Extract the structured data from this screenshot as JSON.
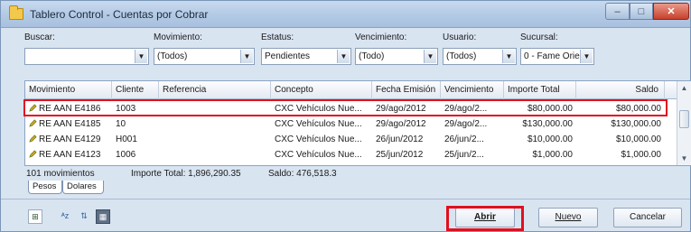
{
  "window": {
    "title": "Tablero Control - Cuentas por Cobrar",
    "controls": {
      "minimize": "–",
      "maximize": "□",
      "close": "✕"
    }
  },
  "filters": {
    "buscar": {
      "label": "Buscar:",
      "value": ""
    },
    "movimiento": {
      "label": "Movimiento:",
      "value": "(Todos)"
    },
    "estatus": {
      "label": "Estatus:",
      "value": "Pendientes"
    },
    "vencimiento": {
      "label": "Vencimiento:",
      "value": "(Todo)"
    },
    "usuario": {
      "label": "Usuario:",
      "value": "(Todos)"
    },
    "sucursal": {
      "label": "Sucursal:",
      "value": "0 - Fame Orie"
    }
  },
  "grid": {
    "columns": [
      "Movimiento",
      "Cliente",
      "Referencia",
      "Concepto",
      "Fecha Emisión",
      "Vencimiento",
      "Importe Total",
      "Saldo"
    ],
    "rows": [
      {
        "movimiento": "RE AAN E4186",
        "cliente": "1003",
        "referencia": "",
        "concepto": "CXC Vehículos Nue...",
        "fecha": "29/ago/2012",
        "vencimiento": "29/ago/2...",
        "importe": "$80,000.00",
        "saldo": "$80,000.00"
      },
      {
        "movimiento": "RE AAN E4185",
        "cliente": "10",
        "referencia": "",
        "concepto": "CXC Vehículos Nue...",
        "fecha": "29/ago/2012",
        "vencimiento": "29/ago/2...",
        "importe": "$130,000.00",
        "saldo": "$130,000.00"
      },
      {
        "movimiento": "RE AAN E4129",
        "cliente": "H001",
        "referencia": "",
        "concepto": "CXC Vehículos Nue...",
        "fecha": "26/jun/2012",
        "vencimiento": "26/jun/2...",
        "importe": "$10,000.00",
        "saldo": "$10,000.00"
      },
      {
        "movimiento": "RE AAN E4123",
        "cliente": "1006",
        "referencia": "",
        "concepto": "CXC Vehículos Nue...",
        "fecha": "25/jun/2012",
        "vencimiento": "25/jun/2...",
        "importe": "$1,000.00",
        "saldo": "$1,000.00"
      }
    ]
  },
  "summary": {
    "count": "101 movimientos",
    "importe_total": "Importe Total: 1,896,290.35",
    "saldo": "Saldo: 476,518.3"
  },
  "tabs": [
    "Pesos",
    "Dolares"
  ],
  "toolbar": {
    "icons": [
      "excel-export-icon",
      "sort-icon",
      "filter-icon",
      "grid-view-icon"
    ]
  },
  "buttons": {
    "abrir": "Abrir",
    "nuevo": "Nuevo",
    "cancelar": "Cancelar"
  },
  "colors": {
    "highlight": "#e0101e",
    "titlebar": "#b4cbe6",
    "background": "#d9e4f1"
  }
}
